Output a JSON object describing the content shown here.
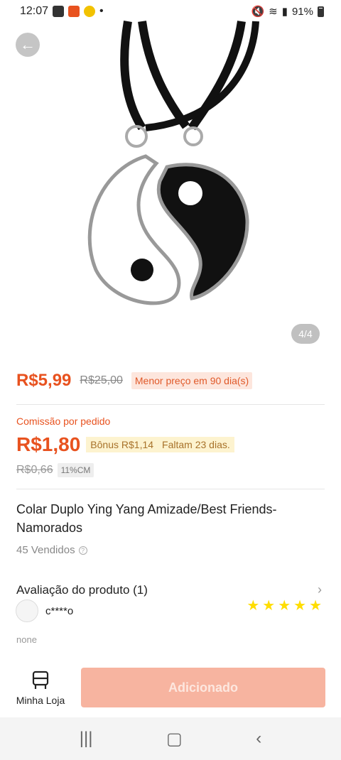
{
  "statusbar": {
    "time": "12:07",
    "dot": "•",
    "battery": "91%",
    "icons": [
      "gallery-icon",
      "app-icon",
      "smiley-icon",
      "mute-icon",
      "wifi-icon",
      "signal-icon",
      "battery-icon"
    ]
  },
  "gallery": {
    "counter": "4/4"
  },
  "price": {
    "current": "R$5,99",
    "original": "R$25,00",
    "badge": "Menor preço em 90 dia(s)"
  },
  "commission": {
    "label": "Comissão por pedido",
    "value": "R$1,80",
    "bonus": "Bônus R$1,14",
    "days_left": "Faltam 23 dias.",
    "old_value": "R$0,66",
    "rate": "11%CM"
  },
  "product": {
    "title": "Colar Duplo Ying Yang Amizade/Best Friends-Namorados",
    "sold": "45 Vendidos"
  },
  "reviews": {
    "title": "Avaliação do produto (1)",
    "reviewer": "c****o",
    "stars": 5,
    "variant": "none"
  },
  "bottom": {
    "store_label": "Minha Loja",
    "add_label": "Adicionado"
  },
  "colors": {
    "accent": "#e8521f",
    "star": "#ffdd00",
    "add_button": "#f7b4a0"
  }
}
